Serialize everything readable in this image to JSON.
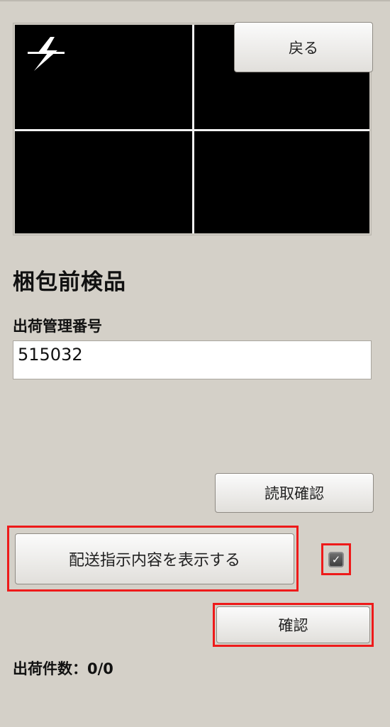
{
  "camera": {
    "flash_icon": "lightning-bolt-icon"
  },
  "buttons": {
    "back_label": "戻る",
    "read_confirm_label": "読取確認",
    "show_instructions_label": "配送指示内容を表示する",
    "confirm_label": "確認"
  },
  "page": {
    "title": "梱包前検品"
  },
  "form": {
    "shipping_number_label": "出荷管理番号",
    "shipping_number_value": "515032"
  },
  "checkbox": {
    "checked": true,
    "mark": "✓"
  },
  "status": {
    "count_label": "出荷件数：",
    "count_value": "0/0"
  },
  "colors": {
    "background": "#d4d0c8",
    "highlight": "#ee1a1a",
    "camera_background": "#000000"
  }
}
